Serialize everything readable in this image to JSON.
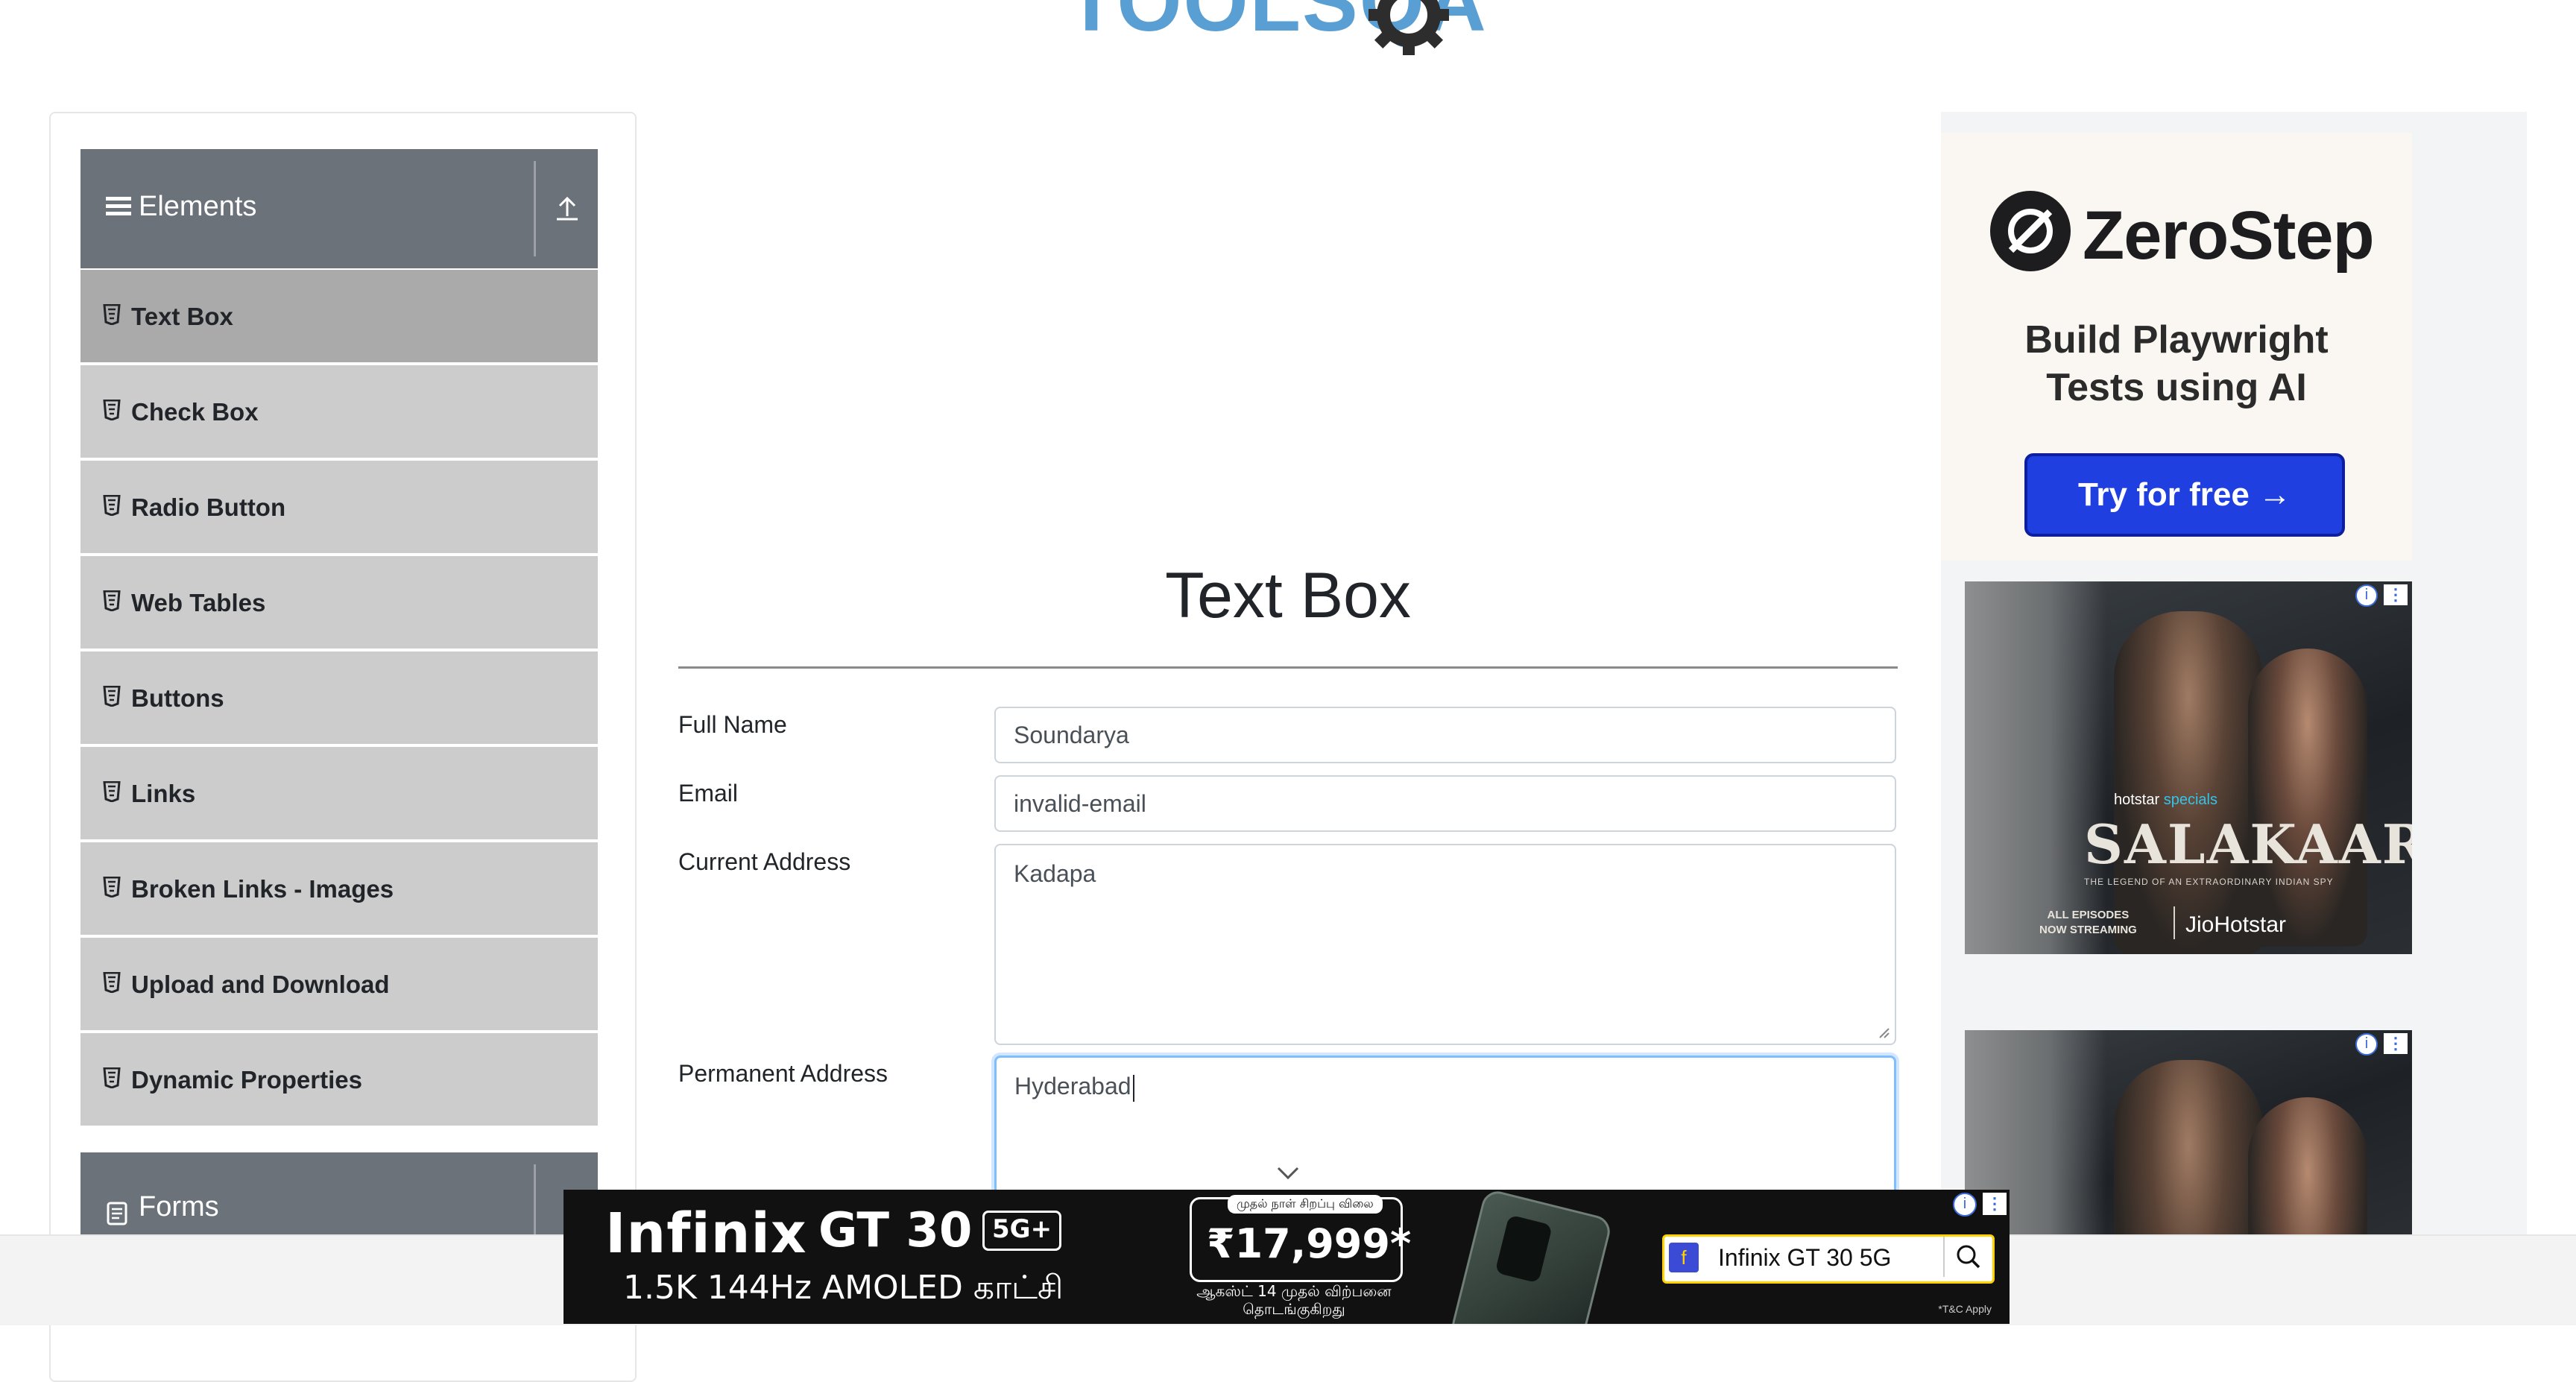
{
  "header": {
    "logo_text": "TOOLSQA"
  },
  "sidebar": {
    "elements_header": "Elements",
    "items": [
      {
        "label": "Text Box"
      },
      {
        "label": "Check Box"
      },
      {
        "label": "Radio Button"
      },
      {
        "label": "Web Tables"
      },
      {
        "label": "Buttons"
      },
      {
        "label": "Links"
      },
      {
        "label": "Broken Links - Images"
      },
      {
        "label": "Upload and Download"
      },
      {
        "label": "Dynamic Properties"
      }
    ],
    "forms_header": "Forms"
  },
  "main": {
    "title": "Text Box",
    "fields": {
      "full_name": {
        "label": "Full Name",
        "value": "Soundarya"
      },
      "email": {
        "label": "Email",
        "value": "invalid-email"
      },
      "current_address": {
        "label": "Current Address",
        "value": "Kadapa"
      },
      "permanent_address": {
        "label": "Permanent Address",
        "value": "Hyderabad"
      }
    }
  },
  "ads": {
    "zerostep": {
      "brand": "ZeroStep",
      "tagline_line1": "Build Playwright",
      "tagline_line2": "Tests using AI",
      "cta": "Try for free →"
    },
    "movie": {
      "platform_prefix": "hotstar",
      "platform_suffix": "specials",
      "title": "SALAKAAR",
      "subtitle": "THE LEGEND OF AN EXTRAORDINARY INDIAN SPY",
      "footer_line1": "ALL EPISODES",
      "footer_line2": "NOW STREAMING",
      "footer_brand": "JioHotstar"
    },
    "infinix": {
      "brand": "Infinix",
      "model": "GT 30",
      "badge": "5G+",
      "spec": "1.5K 144Hz AMOLED காட்சி",
      "price_caption": "முதல் நாள் சிறப்பு விலை",
      "price": "₹17,999*",
      "date_line1": "ஆகஸ்ட் 14 முதல் விற்பனை",
      "date_line2": "தொடங்குகிறது",
      "search_text": "Infinix GT 30 5G",
      "tc": "*T&C Apply"
    }
  },
  "colors": {
    "sidebar_header": "#6b727a",
    "menu_item": "#cccccc",
    "menu_item_active": "#aaaaaa",
    "focus_border": "#80bdff",
    "cta_blue": "#1f3fe0",
    "logo_blue": "#5a9fd4"
  }
}
